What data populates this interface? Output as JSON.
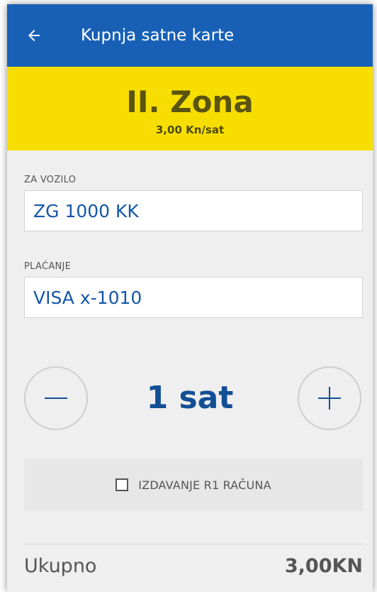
{
  "appbar": {
    "title": "Kupnja satne karte",
    "back_icon": "arrow-left-icon"
  },
  "zone": {
    "name": "II. Zona",
    "price": "3,00 Kn/sat"
  },
  "vehicle": {
    "label": "ZA VOZILO",
    "value": "ZG 1000 KK"
  },
  "payment": {
    "label": "PLAĆANJE",
    "value": "VISA x-1010"
  },
  "duration": {
    "value": "1 sat",
    "decrement_icon": "minus-icon",
    "increment_icon": "plus-icon"
  },
  "r1_invoice": {
    "label": "IZDAVANJE R1 RAČUNA",
    "checked": false
  },
  "total": {
    "label": "Ukupno",
    "value": "3,00KN"
  },
  "colors": {
    "appbar": "#1760b6",
    "zone_banner": "#f8de00",
    "accent_text": "#1457a8"
  }
}
